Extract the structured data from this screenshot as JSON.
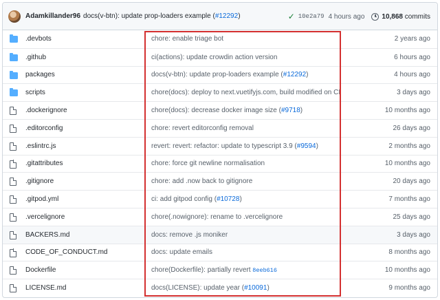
{
  "latest_commit": {
    "author": "Adamkillander96",
    "message_prefix": "docs(v-btn): update prop-loaders example (",
    "message_link": "#12292",
    "message_suffix": ")",
    "sha": "10e2a79",
    "time": "4 hours ago",
    "commit_count": "10,868",
    "commits_label": "commits",
    "status": "success",
    "status_icon": "check-icon",
    "history_icon": "history-icon"
  },
  "files": [
    {
      "name": ".devbots",
      "type": "folder",
      "msg": "chore: enable triage bot",
      "link": "",
      "msg_after": "",
      "time": "2 years ago"
    },
    {
      "name": ".github",
      "type": "folder",
      "msg": "ci(actions): update crowdin action version",
      "link": "",
      "msg_after": "",
      "time": "6 hours ago"
    },
    {
      "name": "packages",
      "type": "folder",
      "msg": "docs(v-btn): update prop-loaders example (",
      "link": "#12292",
      "msg_after": ")",
      "time": "4 hours ago"
    },
    {
      "name": "scripts",
      "type": "folder",
      "msg": "chore(docs): deploy to next.vuetifyjs.com, build modified on CI",
      "link": "",
      "msg_after": "",
      "time": "3 days ago"
    },
    {
      "name": ".dockerignore",
      "type": "file",
      "msg": "chore(docs): decrease docker image size (",
      "link": "#9718",
      "msg_after": ")",
      "time": "10 months ago"
    },
    {
      "name": ".editorconfig",
      "type": "file",
      "msg": "chore: revert editorconfig removal",
      "link": "",
      "msg_after": "",
      "time": "26 days ago"
    },
    {
      "name": ".eslintrc.js",
      "type": "file",
      "msg": "revert: revert: refactor: update to typescript 3.9 (",
      "link": "#9594",
      "msg_after": ")",
      "time": "2 months ago"
    },
    {
      "name": ".gitattributes",
      "type": "file",
      "msg": "chore: force git newline normalisation",
      "link": "",
      "msg_after": "",
      "time": "10 months ago"
    },
    {
      "name": ".gitignore",
      "type": "file",
      "msg": "chore: add .now back to gitignore",
      "link": "",
      "msg_after": "",
      "time": "20 days ago"
    },
    {
      "name": ".gitpod.yml",
      "type": "file",
      "msg": "ci: add gitpod config (",
      "link": "#10728",
      "msg_after": ")",
      "time": "7 months ago"
    },
    {
      "name": ".vercelignore",
      "type": "file",
      "msg": "chore(.nowignore): rename to .vercelignore",
      "link": "",
      "msg_after": "",
      "time": "25 days ago"
    },
    {
      "name": "BACKERS.md",
      "type": "file",
      "msg": "docs: remove .js moniker",
      "link": "",
      "msg_after": "",
      "time": "3 days ago"
    },
    {
      "name": "CODE_OF_CONDUCT.md",
      "type": "file",
      "msg": "docs: update emails",
      "link": "",
      "msg_after": "",
      "time": "8 months ago"
    },
    {
      "name": "Dockerfile",
      "type": "file",
      "msg": "chore(Dockerfile): partially revert ",
      "link": "8eeb616",
      "msg_after": "",
      "time": "10 months ago"
    },
    {
      "name": "LICENSE.md",
      "type": "file",
      "msg": "docs(LICENSE): update year (",
      "link": "#10091",
      "msg_after": ")",
      "time": "9 months ago"
    }
  ],
  "hovered_row": 11,
  "highlight_color": "#d32f2f",
  "colors": {
    "link": "#0969da",
    "folder": "#54aeff",
    "success": "#1a7f37"
  }
}
